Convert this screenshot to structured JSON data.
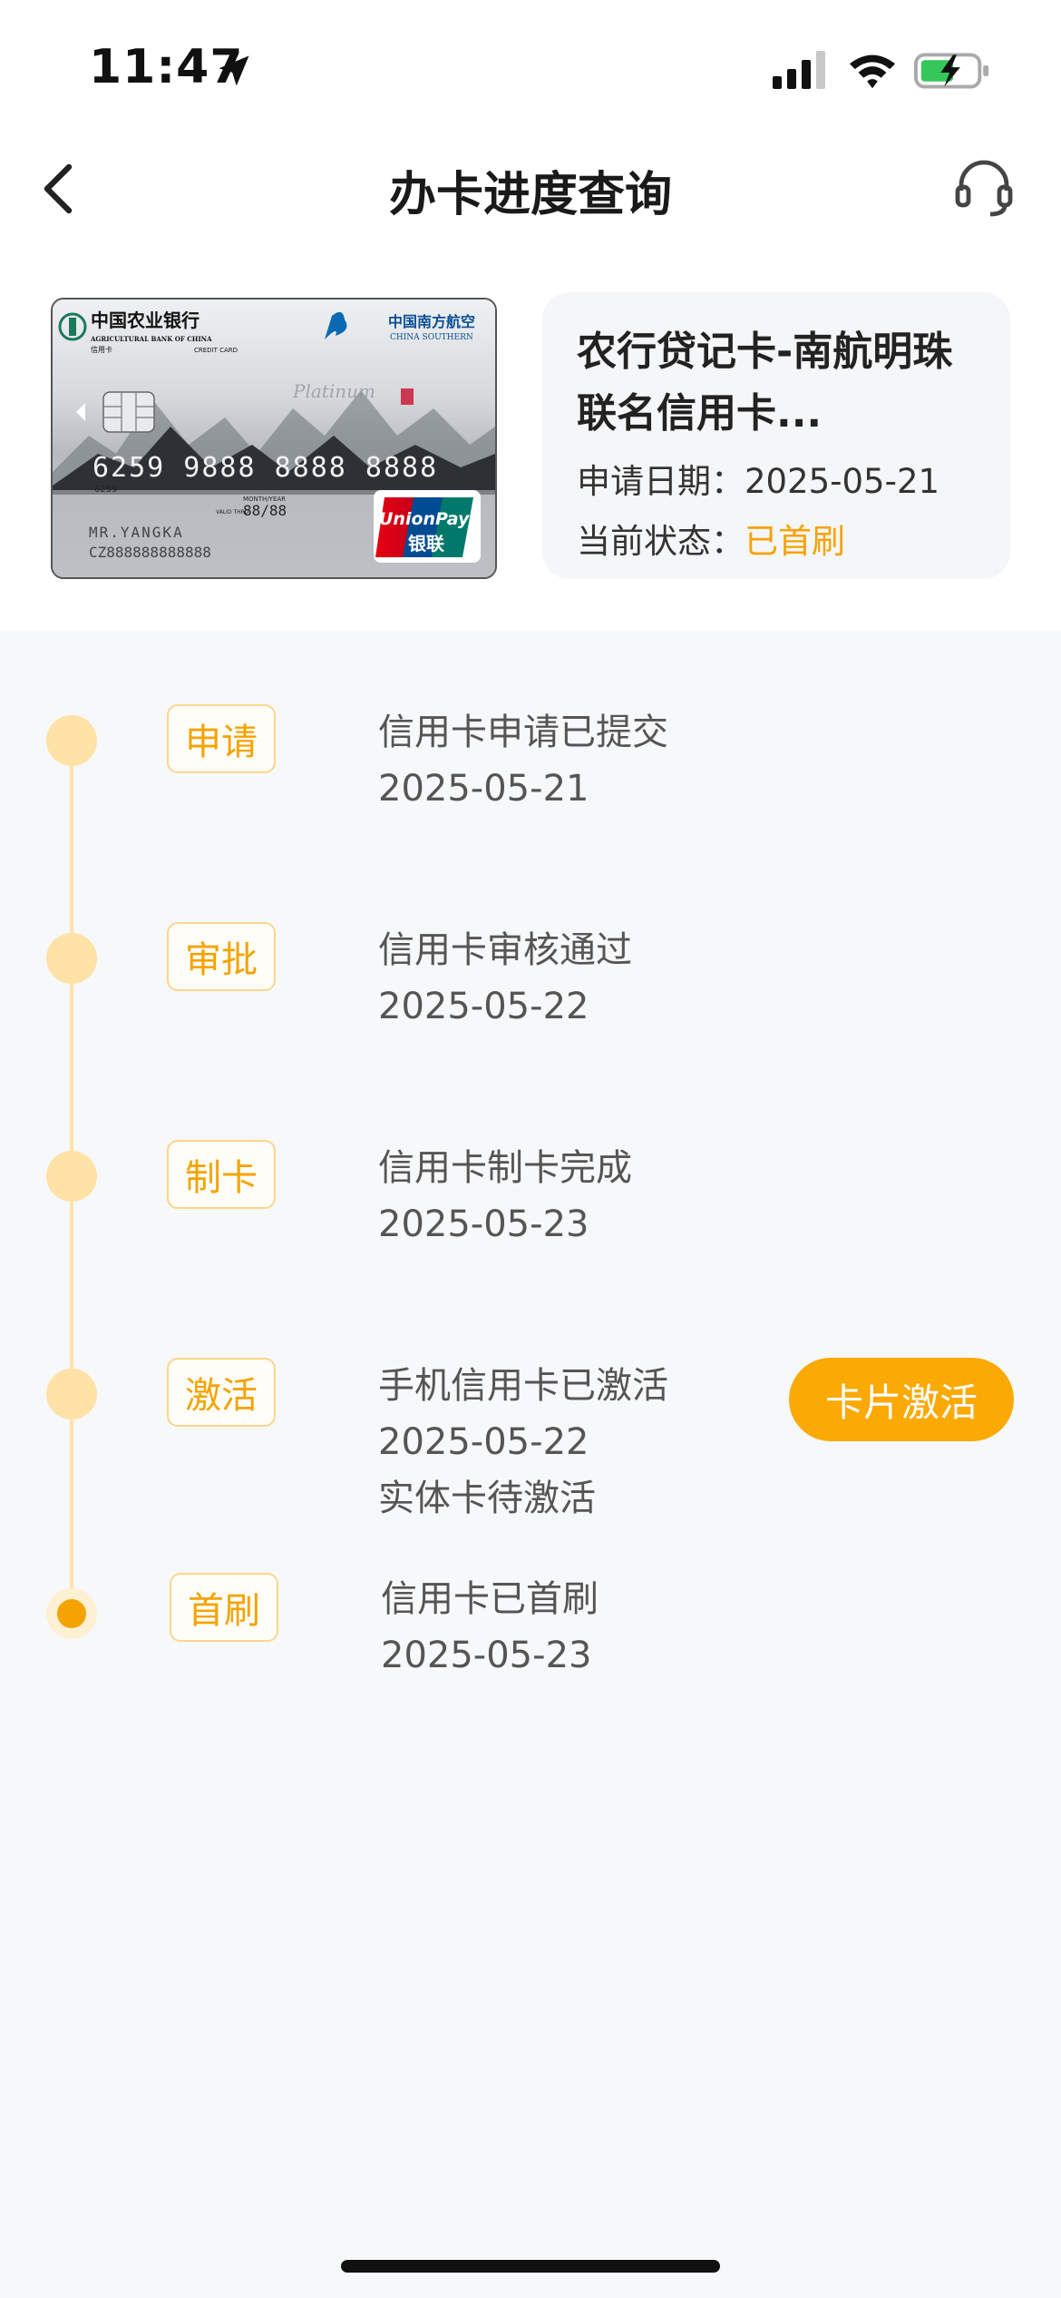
{
  "status_bar": {
    "time": "11:47"
  },
  "nav": {
    "title": "办卡进度查询"
  },
  "card": {
    "name": "农行贷记卡-南航明珠联名信用卡...",
    "apply_date_label": "申请日期：",
    "apply_date": "2025-05-21",
    "status_label": "当前状态：",
    "status_value": "已首刷",
    "image_text": {
      "bank_cn": "中国农业银行",
      "bank_en": "AGRICULTURAL BANK OF CHINA",
      "card_type_cn": "信用卡",
      "card_type_en": "CREDIT CARD",
      "airline_cn": "中国南方航空",
      "airline_en": "CHINA SOUTHERN",
      "platinum": "Platinum",
      "number": "6259  9888  8888  8888",
      "number_small": "6259",
      "expiry_label": "MONTH/YEAR",
      "valid_thru": "VALID THRU",
      "expiry": "88/88",
      "holder": "MR.YANGKA",
      "holder_id": "CZ888888888888",
      "unionpay_en": "UnionPay",
      "unionpay_cn": "银联"
    }
  },
  "timeline": [
    {
      "tag": "申请",
      "lines": [
        "信用卡申请已提交",
        "2025-05-21"
      ]
    },
    {
      "tag": "审批",
      "lines": [
        "信用卡审核通过",
        "2025-05-22"
      ]
    },
    {
      "tag": "制卡",
      "lines": [
        "信用卡制卡完成",
        "2025-05-23"
      ]
    },
    {
      "tag": "激活",
      "lines": [
        "手机信用卡已激活",
        "2025-05-22",
        "实体卡待激活"
      ]
    },
    {
      "tag": "首刷",
      "lines": [
        "信用卡已首刷",
        "2025-05-23"
      ]
    }
  ],
  "actions": {
    "activate_label": "卡片激活"
  },
  "colors": {
    "accent": "#f5a300",
    "button": "#fba905",
    "dot": "#fee2a6",
    "line": "#fde3a8"
  }
}
